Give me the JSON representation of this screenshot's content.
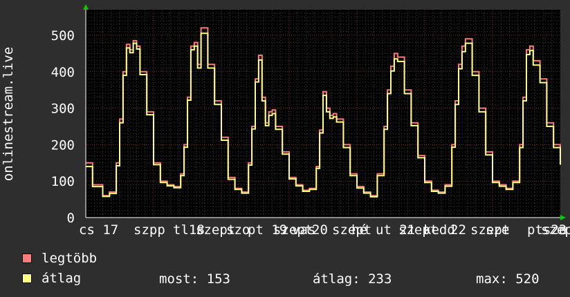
{
  "chart_data": {
    "type": "line",
    "ylabel": "onlinestream.live",
    "ylim": [
      0,
      570
    ],
    "yticks": [
      0,
      100,
      200,
      300,
      400,
      500
    ],
    "xlim": [
      0,
      7
    ],
    "xtick_labels": [
      "cs 17",
      "szpp",
      "tl18",
      "szept",
      "szo",
      "pt 19",
      "szept",
      "vas",
      "20",
      "szept",
      "hé",
      "ut 21",
      "szept",
      "kedd",
      "22",
      "szept",
      "sze",
      "pt 23",
      "szept",
      "sze"
    ],
    "grid": true,
    "series": [
      {
        "name": "legtöbb",
        "color": "#ff7b7b",
        "x": [
          0,
          0.1,
          0.25,
          0.35,
          0.45,
          0.5,
          0.55,
          0.6,
          0.65,
          0.7,
          0.75,
          0.8,
          0.9,
          1.0,
          1.1,
          1.2,
          1.3,
          1.4,
          1.45,
          1.5,
          1.55,
          1.6,
          1.65,
          1.7,
          1.8,
          1.9,
          2.0,
          2.1,
          2.2,
          2.3,
          2.4,
          2.45,
          2.5,
          2.55,
          2.6,
          2.65,
          2.7,
          2.75,
          2.8,
          2.9,
          3.0,
          3.1,
          3.2,
          3.3,
          3.4,
          3.45,
          3.5,
          3.55,
          3.6,
          3.65,
          3.7,
          3.8,
          3.9,
          4.0,
          4.1,
          4.2,
          4.3,
          4.4,
          4.45,
          4.5,
          4.55,
          4.6,
          4.7,
          4.8,
          4.9,
          5.0,
          5.1,
          5.2,
          5.3,
          5.4,
          5.45,
          5.5,
          5.55,
          5.6,
          5.7,
          5.8,
          5.9,
          6.0,
          6.1,
          6.2,
          6.3,
          6.4,
          6.45,
          6.5,
          6.55,
          6.6,
          6.7,
          6.8,
          6.9,
          7.0
        ],
        "values": [
          150,
          90,
          60,
          70,
          150,
          270,
          400,
          475,
          460,
          485,
          470,
          400,
          290,
          150,
          100,
          90,
          85,
          120,
          200,
          330,
          470,
          480,
          420,
          520,
          420,
          320,
          220,
          110,
          80,
          70,
          150,
          250,
          380,
          445,
          330,
          260,
          290,
          295,
          250,
          180,
          110,
          90,
          75,
          80,
          140,
          240,
          345,
          300,
          280,
          285,
          270,
          200,
          120,
          85,
          70,
          60,
          120,
          250,
          350,
          415,
          450,
          440,
          350,
          260,
          170,
          100,
          75,
          70,
          90,
          200,
          320,
          420,
          470,
          490,
          400,
          300,
          180,
          100,
          90,
          80,
          100,
          200,
          330,
          460,
          470,
          430,
          380,
          260,
          200,
          150
        ]
      },
      {
        "name": "átlag",
        "color": "#ffff80",
        "x": [
          0,
          0.1,
          0.25,
          0.35,
          0.45,
          0.5,
          0.55,
          0.6,
          0.65,
          0.7,
          0.75,
          0.8,
          0.9,
          1.0,
          1.1,
          1.2,
          1.3,
          1.4,
          1.45,
          1.5,
          1.55,
          1.6,
          1.65,
          1.7,
          1.8,
          1.9,
          2.0,
          2.1,
          2.2,
          2.3,
          2.4,
          2.45,
          2.5,
          2.55,
          2.6,
          2.65,
          2.7,
          2.75,
          2.8,
          2.9,
          3.0,
          3.1,
          3.2,
          3.3,
          3.4,
          3.45,
          3.5,
          3.55,
          3.6,
          3.65,
          3.7,
          3.8,
          3.9,
          4.0,
          4.1,
          4.2,
          4.3,
          4.4,
          4.45,
          4.5,
          4.55,
          4.6,
          4.7,
          4.8,
          4.9,
          5.0,
          5.1,
          5.2,
          5.3,
          5.4,
          5.45,
          5.5,
          5.55,
          5.6,
          5.7,
          5.8,
          5.9,
          6.0,
          6.1,
          6.2,
          6.3,
          6.4,
          6.45,
          6.5,
          6.55,
          6.6,
          6.7,
          6.8,
          6.9,
          7.0
        ],
        "values": [
          140,
          85,
          58,
          66,
          142,
          260,
          390,
          465,
          452,
          478,
          462,
          392,
          282,
          145,
          96,
          87,
          82,
          115,
          193,
          322,
          460,
          470,
          410,
          505,
          410,
          310,
          212,
          105,
          77,
          67,
          144,
          243,
          372,
          432,
          320,
          252,
          280,
          285,
          242,
          174,
          106,
          87,
          72,
          77,
          135,
          232,
          335,
          290,
          272,
          276,
          262,
          192,
          115,
          81,
          67,
          57,
          115,
          242,
          340,
          402,
          435,
          428,
          340,
          252,
          164,
          96,
          72,
          67,
          86,
          193,
          310,
          408,
          455,
          478,
          390,
          290,
          172,
          96,
          86,
          77,
          96,
          192,
          320,
          447,
          458,
          418,
          370,
          250,
          192,
          145
        ]
      }
    ]
  },
  "legend": [
    {
      "label": "legtöbb",
      "color": "#ff7b7b"
    },
    {
      "label": "átlag",
      "color": "#ffff80"
    }
  ],
  "stats": {
    "now_label": "most: 153",
    "avg_label": "átlag: 233",
    "max_label": "max: 520"
  }
}
